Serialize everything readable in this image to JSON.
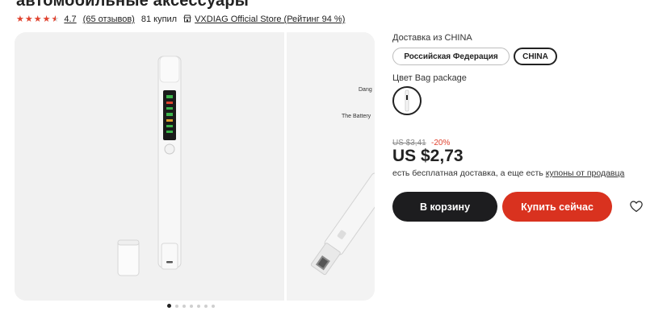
{
  "product": {
    "title_partial": "автомобильные аксессуары",
    "rating": "4.7",
    "reviews": "(65 отзывов)",
    "sold": "81 купил",
    "store": "VXDIAG Official Store (Рейтинг 94 %)"
  },
  "gallery": {
    "slide2_lines": [
      "Dang",
      "The Battery"
    ],
    "dots_count": 7,
    "active_dot": 0
  },
  "options": {
    "delivery_label": "Доставка из CHINA",
    "delivery_choices": [
      "Российская Федерация",
      "CHINA"
    ],
    "selected_delivery": "CHINA",
    "color_label": "Цвет Bag package"
  },
  "pricing": {
    "old_price": "US $3,41",
    "discount": "-20%",
    "price": "US $2,73",
    "shipping_text": "есть бесплатная доставка, а еще есть ",
    "shipping_link": "купоны от продавца"
  },
  "actions": {
    "cart": "В корзину",
    "buy_now": "Купить сейчас"
  },
  "colors": {
    "accent_red": "#d9321f",
    "dark_button": "#1d1d1f",
    "star": "#e0422e"
  }
}
